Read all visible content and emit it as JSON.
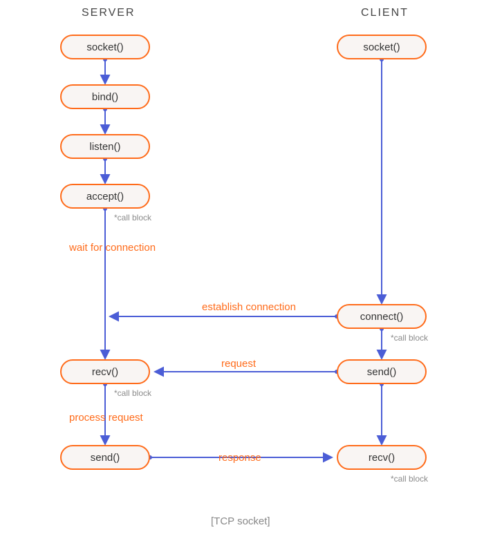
{
  "columns": {
    "server": "SERVER",
    "client": "CLIENT"
  },
  "server": [
    {
      "label": "socket()"
    },
    {
      "label": "bind()"
    },
    {
      "label": "listen()"
    },
    {
      "label": "accept()"
    },
    {
      "label": "recv()"
    },
    {
      "label": "send()"
    }
  ],
  "client": [
    {
      "label": "socket()"
    },
    {
      "label": "connect()"
    },
    {
      "label": "send()"
    },
    {
      "label": "recv()"
    }
  ],
  "notes": {
    "server_accept": "*call block",
    "server_recv": "*call block",
    "client_connect": "*call block",
    "client_recv": "*call block"
  },
  "labels": {
    "wait": "wait for connection",
    "establish": "establish connection",
    "request": "request",
    "process": "process request",
    "response": "response"
  },
  "caption": "[TCP socket]",
  "chart_data": {
    "type": "flowchart",
    "title": "[TCP socket]",
    "columns": [
      "SERVER",
      "CLIENT"
    ],
    "nodes": [
      {
        "id": "s_socket",
        "column": "SERVER",
        "label": "socket()"
      },
      {
        "id": "s_bind",
        "column": "SERVER",
        "label": "bind()"
      },
      {
        "id": "s_listen",
        "column": "SERVER",
        "label": "listen()"
      },
      {
        "id": "s_accept",
        "column": "SERVER",
        "label": "accept()",
        "note": "*call block"
      },
      {
        "id": "s_recv",
        "column": "SERVER",
        "label": "recv()",
        "note": "*call block"
      },
      {
        "id": "s_send",
        "column": "SERVER",
        "label": "send()"
      },
      {
        "id": "c_socket",
        "column": "CLIENT",
        "label": "socket()"
      },
      {
        "id": "c_connect",
        "column": "CLIENT",
        "label": "connect()",
        "note": "*call block"
      },
      {
        "id": "c_send",
        "column": "CLIENT",
        "label": "send()"
      },
      {
        "id": "c_recv",
        "column": "CLIENT",
        "label": "recv()",
        "note": "*call block"
      }
    ],
    "edges": [
      {
        "from": "s_socket",
        "to": "s_bind"
      },
      {
        "from": "s_bind",
        "to": "s_listen"
      },
      {
        "from": "s_listen",
        "to": "s_accept"
      },
      {
        "from": "s_accept",
        "to": "s_recv",
        "label": "wait for connection"
      },
      {
        "from": "s_recv",
        "to": "s_send",
        "label": "process request"
      },
      {
        "from": "c_socket",
        "to": "c_connect"
      },
      {
        "from": "c_connect",
        "to": "c_send"
      },
      {
        "from": "c_send",
        "to": "c_recv"
      },
      {
        "from": "c_connect",
        "to": "s_accept",
        "label": "establish connection"
      },
      {
        "from": "c_send",
        "to": "s_recv",
        "label": "request"
      },
      {
        "from": "s_send",
        "to": "c_recv",
        "label": "response"
      }
    ]
  }
}
